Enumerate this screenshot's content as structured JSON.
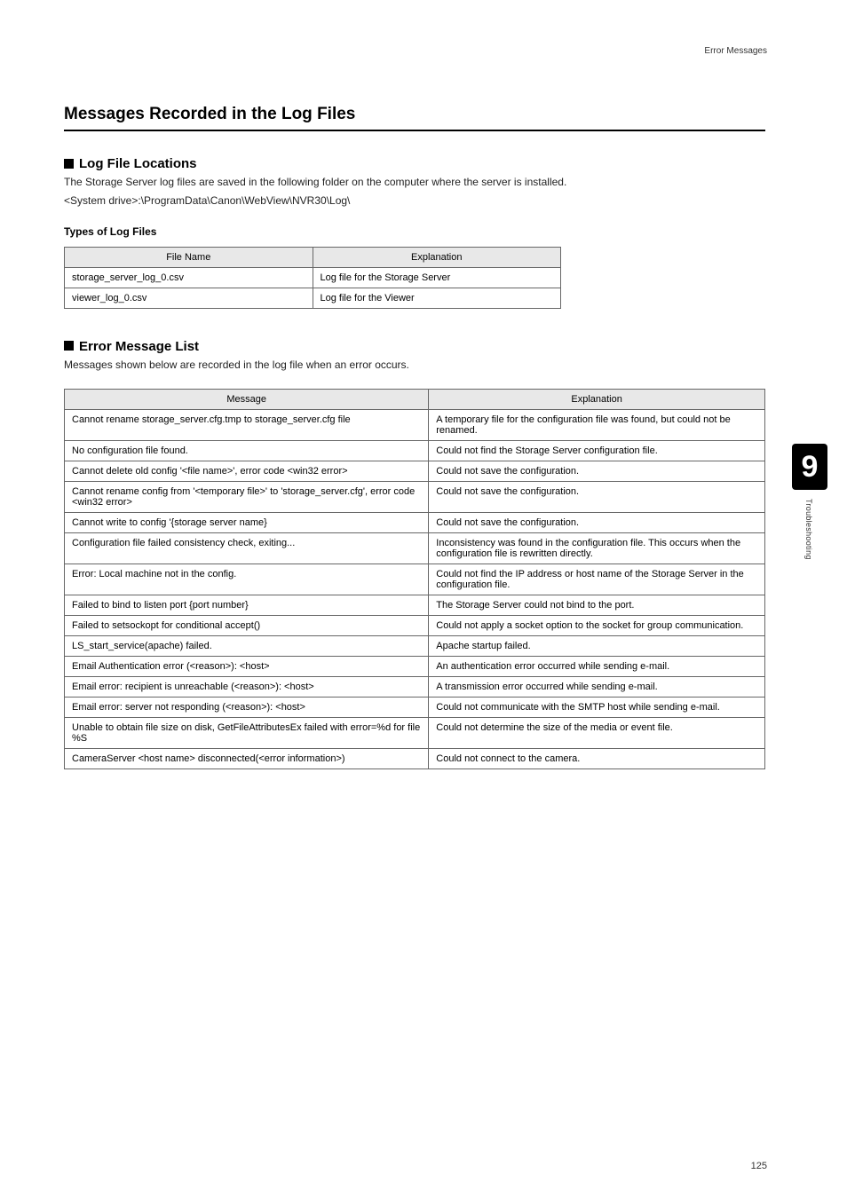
{
  "header": {
    "topic": "Error Messages"
  },
  "section_title": "Messages Recorded in the Log Files",
  "log_locations": {
    "heading": "Log File Locations",
    "intro1": "The Storage Server log files are saved in the following folder on the computer where the server is installed.",
    "intro2": "<System drive>:\\ProgramData\\Canon\\WebView\\NVR30\\Log\\",
    "types_label": "Types of Log Files",
    "table": {
      "headers": [
        "File Name",
        "Explanation"
      ],
      "rows": [
        [
          "storage_server_log_0.csv",
          "Log file for the Storage Server"
        ],
        [
          "viewer_log_0.csv",
          "Log file for the Viewer"
        ]
      ]
    }
  },
  "error_list": {
    "heading": "Error Message List",
    "intro": "Messages shown below are recorded in the log file when an error occurs.",
    "table": {
      "headers": [
        "Message",
        "Explanation"
      ],
      "rows": [
        [
          "Cannot rename storage_server.cfg.tmp to storage_server.cfg file",
          "A temporary file for the configuration file was found, but could not be renamed."
        ],
        [
          "No configuration file found.",
          "Could not find the Storage Server configuration file."
        ],
        [
          "Cannot delete old config '<file name>', error code <win32 error>",
          "Could not save the configuration."
        ],
        [
          "Cannot rename config from '<temporary file>' to 'storage_server.cfg', error code <win32 error>",
          "Could not save the configuration."
        ],
        [
          "Cannot write to config '{storage server name}",
          "Could not save the configuration."
        ],
        [
          "Configuration file failed consistency check, exiting...",
          "Inconsistency was found in the configuration file. This occurs when the configuration file is rewritten directly."
        ],
        [
          "Error: Local machine not in the config.",
          "Could not find the IP address or host name of the Storage Server in the configuration file."
        ],
        [
          "Failed to bind to listen port {port number}",
          "The Storage Server could not bind to the port."
        ],
        [
          "Failed to setsockopt for conditional accept()",
          "Could not apply a socket option to the socket for group communication."
        ],
        [
          "LS_start_service(apache) failed.",
          "Apache startup failed."
        ],
        [
          "Email Authentication error (<reason>): <host>",
          "An authentication error occurred while sending e-mail."
        ],
        [
          "Email error: recipient is unreachable (<reason>): <host>",
          "A transmission error occurred while sending e-mail."
        ],
        [
          "Email error: server not responding (<reason>): <host>",
          "Could not communicate with the SMTP host while sending e-mail."
        ],
        [
          "Unable to obtain file size on disk, GetFileAttributesEx failed with error=%d for file %S",
          "Could not determine the size of the media or event file."
        ],
        [
          "CameraServer <host name> disconnected(<error information>)",
          "Could not connect to the camera."
        ]
      ]
    }
  },
  "side": {
    "chapter": "9",
    "label": "Troubleshooting"
  },
  "page": "125"
}
